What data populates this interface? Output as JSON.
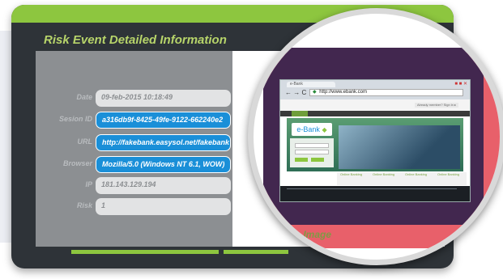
{
  "panel_title": "Risk Event Detailed Information",
  "fields": [
    {
      "label": "Date",
      "value": "09-feb-2015 10:18:49"
    },
    {
      "label": "Sesion ID",
      "value": "a316db9f-8425-49fe-9122-662240e2"
    },
    {
      "label": "URL",
      "value": "http://fakebank.easysol.net/fakebank"
    },
    {
      "label": "Browser",
      "value": "Mozilla/5.0 (Windows NT 6.1, WOW)"
    },
    {
      "label": "IP",
      "value": "181.143.129.194"
    },
    {
      "label": "Risk",
      "value": "1"
    }
  ],
  "image_caption": "ll Size Image",
  "browser": {
    "tab_label": "e-Bank",
    "address": "http://www.ebank.com",
    "nav_buttons": "← → C",
    "login_bar": "Already member? Sign in ▸",
    "logo_text": "e-Bank",
    "links": [
      "Online Banking",
      "Online Banking",
      "Online Banking",
      "Online Banking"
    ]
  },
  "colors": {
    "frame": "#2e3338",
    "accent": "#8dc63f",
    "title": "#b7d46a",
    "selected_field": "#1a8fd8",
    "screenshot_bg": "#42274f",
    "highlight": "#e8606a"
  }
}
